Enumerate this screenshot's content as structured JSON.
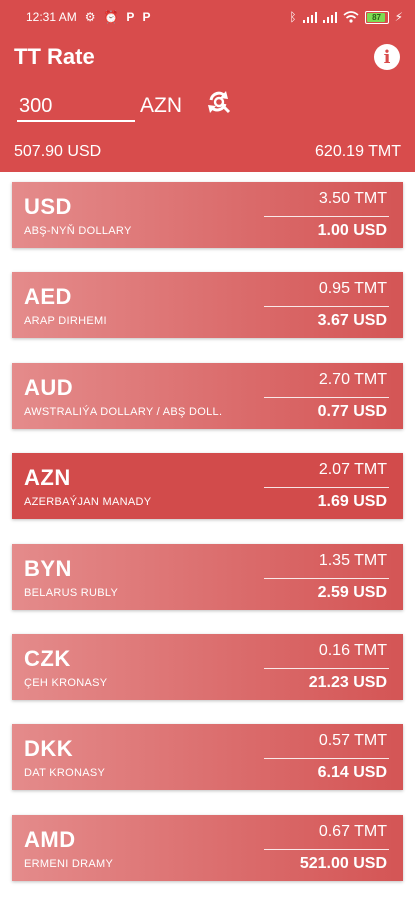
{
  "status": {
    "time": "12:31 AM",
    "battery": "87"
  },
  "header": {
    "title": "TT Rate",
    "amount": "300",
    "currency": "AZN",
    "converted_usd": "507.90 USD",
    "converted_tmt": "620.19 TMT"
  },
  "currencies": [
    {
      "code": "USD",
      "name": "ABŞ-NYŇ DOLLARY",
      "tmt": "3.50 TMT",
      "usd": "1.00 USD"
    },
    {
      "code": "AED",
      "name": "ARAP DIRHEMI",
      "tmt": "0.95 TMT",
      "usd": "3.67 USD"
    },
    {
      "code": "AUD",
      "name": "AWSTRALIÝA DOLLARY / ABŞ DOLL.",
      "tmt": "2.70 TMT",
      "usd": "0.77 USD"
    },
    {
      "code": "AZN",
      "name": "AZERBAÝJAN MANADY",
      "tmt": "2.07 TMT",
      "usd": "1.69 USD"
    },
    {
      "code": "BYN",
      "name": "BELARUS RUBLY",
      "tmt": "1.35 TMT",
      "usd": "2.59 USD"
    },
    {
      "code": "CZK",
      "name": "ÇEH KRONASY",
      "tmt": "0.16 TMT",
      "usd": "21.23 USD"
    },
    {
      "code": "DKK",
      "name": "DAT KRONASY",
      "tmt": "0.57 TMT",
      "usd": "6.14 USD"
    },
    {
      "code": "AMD",
      "name": "ERMENI DRAMY",
      "tmt": "0.67 TMT",
      "usd": "521.00 USD"
    }
  ],
  "colors": {
    "primary": "#d84c4c",
    "card_light": "#e48b8b",
    "card_dark": "#d45555"
  },
  "icons": {
    "info": "info-icon",
    "refresh": "refresh-icon"
  }
}
